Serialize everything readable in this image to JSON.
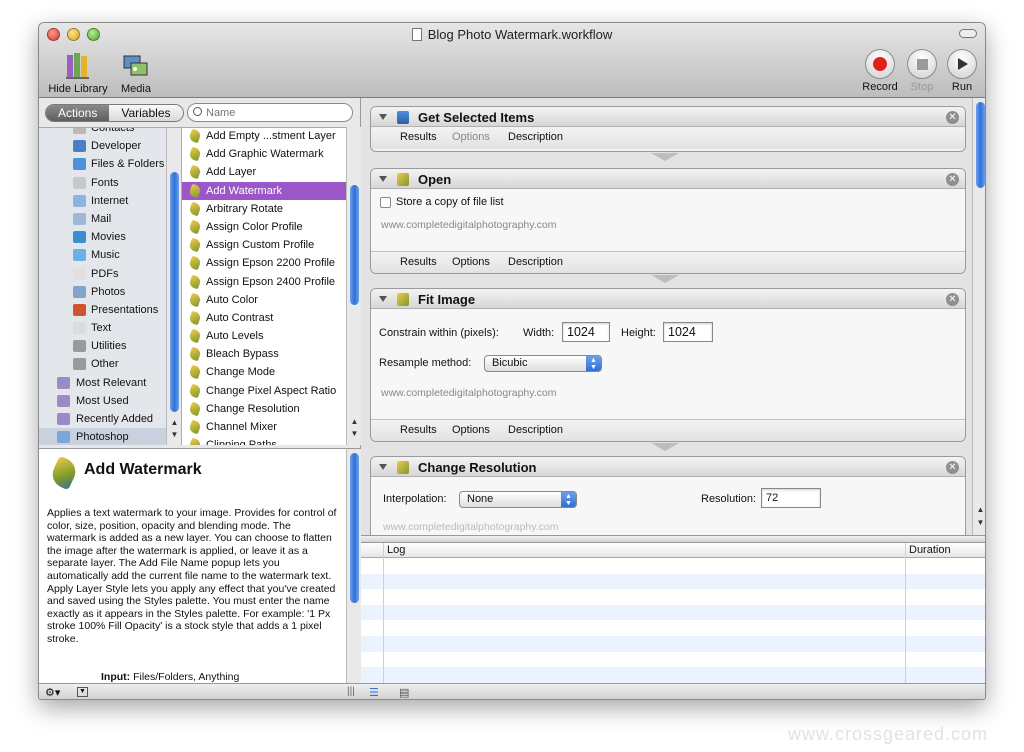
{
  "window": {
    "title": "Blog Photo Watermark.workflow"
  },
  "toolbar": {
    "hide_library": "Hide Library",
    "media": "Media",
    "record": "Record",
    "stop": "Stop",
    "run": "Run"
  },
  "library": {
    "tabs": [
      "Actions",
      "Variables"
    ],
    "search_placeholder": "Name",
    "items": [
      {
        "label": "Contacts",
        "icon": "contacts-icon",
        "color": "#b9b9b9",
        "indent": 1
      },
      {
        "label": "Developer",
        "icon": "developer-icon",
        "color": "#4a7fc8",
        "indent": 1
      },
      {
        "label": "Files & Folders",
        "icon": "finder-icon",
        "color": "#4f8fdc",
        "indent": 1
      },
      {
        "label": "Fonts",
        "icon": "fonts-icon",
        "color": "#c8c8c8",
        "indent": 1
      },
      {
        "label": "Internet",
        "icon": "internet-icon",
        "color": "#8bb5e0",
        "indent": 1
      },
      {
        "label": "Mail",
        "icon": "mail-icon",
        "color": "#9fb8d9",
        "indent": 1
      },
      {
        "label": "Movies",
        "icon": "movies-icon",
        "color": "#3b8fd1",
        "indent": 1
      },
      {
        "label": "Music",
        "icon": "music-icon",
        "color": "#6ab0e0",
        "indent": 1
      },
      {
        "label": "PDFs",
        "icon": "pdf-icon",
        "color": "#e0e0e0",
        "indent": 1
      },
      {
        "label": "Photos",
        "icon": "photos-icon",
        "color": "#7fa6c9",
        "indent": 1
      },
      {
        "label": "Presentations",
        "icon": "presentations-icon",
        "color": "#d0542c",
        "indent": 1
      },
      {
        "label": "Text",
        "icon": "text-icon",
        "color": "#dcdcdc",
        "indent": 1
      },
      {
        "label": "Utilities",
        "icon": "utilities-icon",
        "color": "#9a9a9a",
        "indent": 1
      },
      {
        "label": "Other",
        "icon": "other-icon",
        "color": "#9a9a9a",
        "indent": 1
      },
      {
        "label": "Most Relevant",
        "icon": "smart-folder-icon",
        "color": "#9a8ac8",
        "indent": 0
      },
      {
        "label": "Most Used",
        "icon": "smart-folder-icon",
        "color": "#9a8ac8",
        "indent": 0
      },
      {
        "label": "Recently Added",
        "icon": "smart-folder-icon",
        "color": "#9a8ac8",
        "indent": 0
      },
      {
        "label": "Photoshop",
        "icon": "folder-icon",
        "color": "#7aa8d8",
        "indent": 0,
        "selected": true
      }
    ]
  },
  "actions": {
    "items": [
      {
        "label": "Add Empty ...stment Layer"
      },
      {
        "label": "Add Graphic Watermark"
      },
      {
        "label": "Add Layer"
      },
      {
        "label": "Add Watermark",
        "selected": true
      },
      {
        "label": "Arbitrary Rotate"
      },
      {
        "label": "Assign Color Profile"
      },
      {
        "label": "Assign Custom Profile"
      },
      {
        "label": "Assign Epson 2200 Profile"
      },
      {
        "label": "Assign Epson 2400 Profile"
      },
      {
        "label": "Auto Color"
      },
      {
        "label": "Auto Contrast"
      },
      {
        "label": "Auto Levels"
      },
      {
        "label": "Bleach Bypass"
      },
      {
        "label": "Change Mode"
      },
      {
        "label": "Change Pixel Aspect Ratio"
      },
      {
        "label": "Change Resolution"
      },
      {
        "label": "Channel Mixer"
      },
      {
        "label": "Clipping Paths"
      }
    ]
  },
  "description": {
    "title": "Add Watermark",
    "text": "Applies a text watermark to your image. Provides for control of color, size, position, opacity and blending mode. The watermark is added as a new layer. You can choose to flatten the image after the watermark is applied, or leave it as a separate layer. The Add File Name popup lets you automatically add the current file name to the watermark text. Apply Layer Style lets you apply any effect that you've created and saved using the Styles palette. You must enter the name exactly as it appears in the Styles palette. For example: '1 Px stroke 100% Fill Opacity' is a stock style that adds a 1 pixel stroke.",
    "input_label": "Input:",
    "input_value": "Files/Folders, Anything"
  },
  "workflow": {
    "footer_tabs": [
      "Results",
      "Options",
      "Description"
    ],
    "cards": [
      {
        "title": "Get Selected Items"
      },
      {
        "title": "Open",
        "checkbox_label": "Store a copy of file list",
        "url": "www.completedigitalphotography.com"
      },
      {
        "title": "Fit Image",
        "constrain_label": "Constrain within (pixels):",
        "width_label": "Width:",
        "width_value": "1024",
        "height_label": "Height:",
        "height_value": "1024",
        "resample_label": "Resample method:",
        "resample_value": "Bicubic",
        "url": "www.completedigitalphotography.com"
      },
      {
        "title": "Change Resolution",
        "interpolation_label": "Interpolation:",
        "interpolation_value": "None",
        "resolution_label": "Resolution:",
        "resolution_value": "72",
        "url": "www.completedigitalphotography.com"
      }
    ]
  },
  "log": {
    "col_log": "Log",
    "col_duration": "Duration"
  },
  "watermark_text": "www.crossgeared.com"
}
